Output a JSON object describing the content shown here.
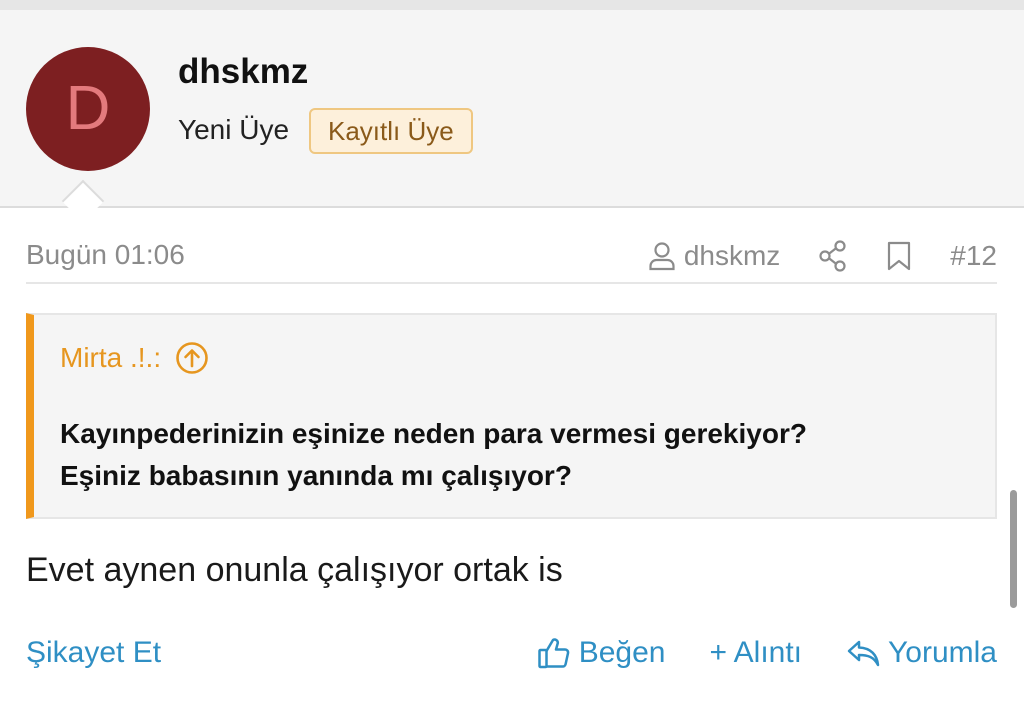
{
  "post": {
    "user": {
      "avatar_letter": "D",
      "avatar_color": "#7d1f21",
      "name": "dhskmz",
      "rank": "Yeni Üye",
      "badge": "Kayıtlı Üye"
    },
    "meta": {
      "date": "Bugün 01:06",
      "author": "dhskmz",
      "post_number": "#12",
      "icons": [
        "user-icon",
        "share-icon",
        "bookmark-icon"
      ]
    },
    "quote": {
      "author": "Mirta .!.:",
      "lines": [
        "Kayınpederinizin eşinize neden para vermesi gerekiyor?",
        "Eşiniz babasının yanında mı çalışıyor?"
      ]
    },
    "body": "Evet aynen onunla çalışıyor ortak is",
    "footer": {
      "report": "Şikayet Et",
      "like": "Beğen",
      "quote": "+ Alıntı",
      "reply": "Yorumla"
    }
  },
  "colors": {
    "accent_blue": "#2f8fc4",
    "quote_orange": "#f0981c",
    "badge_border": "#efc781"
  }
}
